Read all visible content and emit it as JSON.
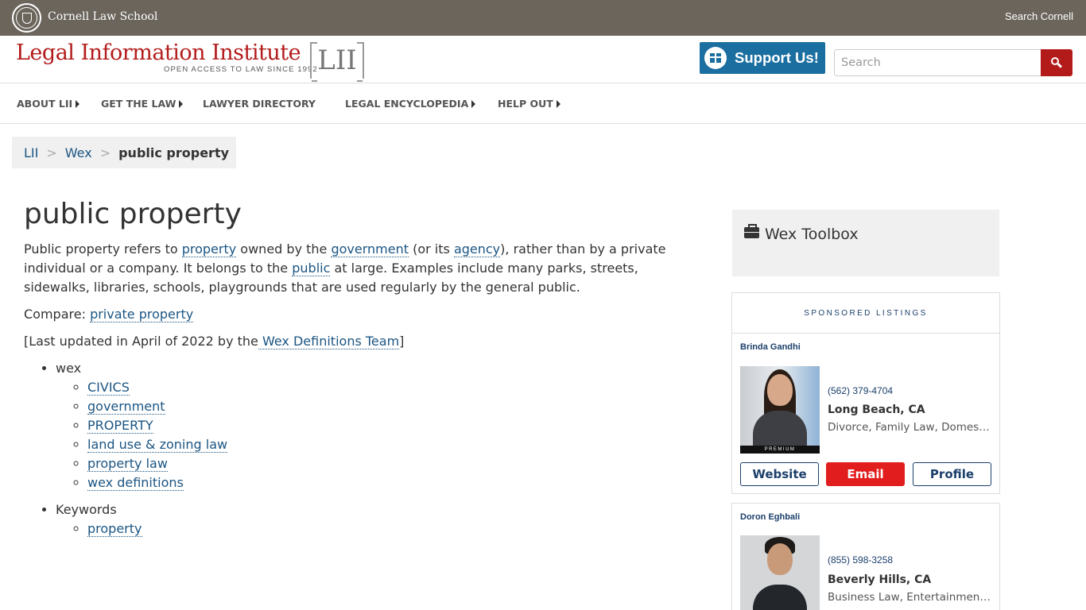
{
  "cornell": {
    "name": "Cornell Law School",
    "search": "Search Cornell"
  },
  "header": {
    "title": "Legal Information Institute",
    "tagline": "OPEN ACCESS TO LAW SINCE 1992",
    "mark": "LII",
    "support_label": "Support Us!",
    "search_placeholder": "Search"
  },
  "nav": [
    {
      "label": "ABOUT LII"
    },
    {
      "label": "GET THE LAW"
    },
    {
      "label": "LAWYER DIRECTORY"
    },
    {
      "label": "LEGAL ENCYCLOPEDIA"
    },
    {
      "label": "HELP OUT"
    }
  ],
  "breadcrumb": {
    "root": "LII",
    "section": "Wex",
    "current": "public property",
    "separator": ">"
  },
  "article": {
    "title": "public property",
    "p1": {
      "t1": "Public property refers to ",
      "l1": "property",
      "t2": " owned by the ",
      "l2": "government",
      "t3": " (or its ",
      "l3": "agency",
      "t4": "), rather than by a private individual or a company. It belongs to the ",
      "l4": "public",
      "t5": " at large. Examples include many parks, streets, sidewalks, libraries, schools, playgrounds that are used regularly by the general public."
    },
    "compare_label": "Compare: ",
    "compare_link": "private property",
    "updated_text": "[Last updated in April of 2022 by the",
    "updated_link": " Wex Definitions Team",
    "updated_end": "]",
    "tags": [
      {
        "label": "wex",
        "items": [
          "CIVICS",
          "government",
          "PROPERTY",
          "land use & zoning law",
          "property law",
          "wex definitions"
        ]
      },
      {
        "label": "Keywords",
        "items": [
          "property"
        ]
      }
    ]
  },
  "sidebar": {
    "toolbox_title": "Wex Toolbox",
    "sponsored_label": "SPONSORED LISTINGS",
    "listings": [
      {
        "name": "Brinda Gandhi",
        "badge": "PREMIUM",
        "phone": "(562) 379-4704",
        "city": "Long Beach, CA",
        "areas": "Divorce, Family Law, Domestic Violence",
        "website_label": "Website",
        "email_label": "Email",
        "profile_label": "Profile"
      },
      {
        "name": "Doron Eghbali",
        "phone": "(855) 598-3258",
        "city": "Beverly Hills, CA",
        "areas": "Business Law, Entertainment Law"
      }
    ]
  },
  "colors": {
    "cornell_bar": "#6b655c",
    "lii_red": "#b31b1b",
    "support_blue": "#1a6ea0",
    "email_red": "#e21d1d",
    "link_blue": "#1b5583"
  }
}
